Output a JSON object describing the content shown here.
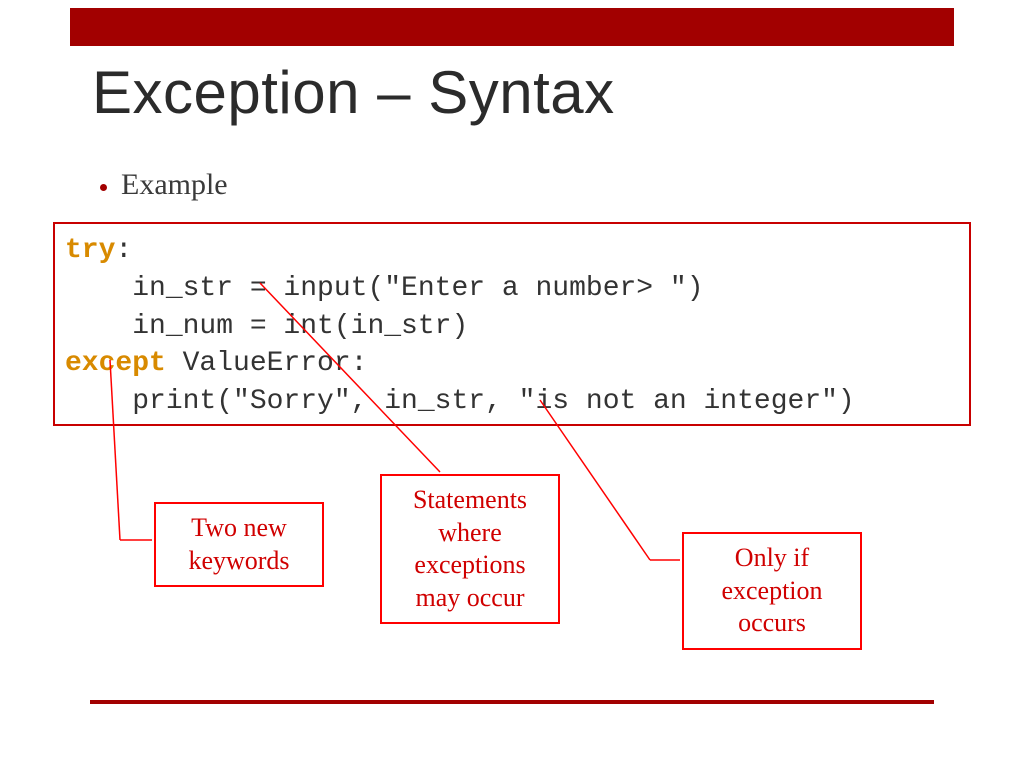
{
  "title": "Exception – Syntax",
  "bullet": "Example",
  "code": {
    "line1_kw": "try",
    "line1_rest": ":",
    "line2": "    in_str = input(\"Enter a number> \")",
    "line3": "    in_num = int(in_str)",
    "line4_kw": "except",
    "line4_rest": " ValueError:",
    "line5": "    print(\"Sorry\", in_str, \"is not an integer\")"
  },
  "callouts": {
    "keywords": "Two new keywords",
    "statements": "Statements where exceptions may occur",
    "only_if": "Only if exception occurs"
  }
}
